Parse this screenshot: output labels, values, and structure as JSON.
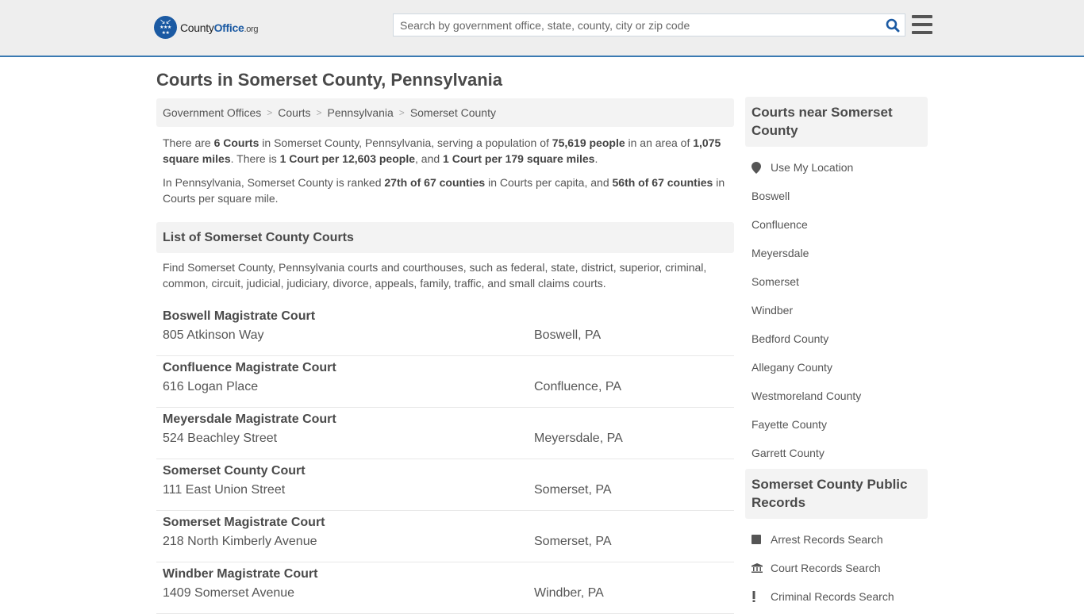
{
  "header": {
    "logo": {
      "county": "County",
      "office": "Office",
      "org": ".org"
    },
    "search_placeholder": "Search by government office, state, county, city or zip code",
    "search_value": ""
  },
  "colors": {
    "brand": "#1b5aa3",
    "header_border": "#3a7ab2",
    "header_bg": "#eeeeee",
    "panel_bg": "#f3f3f3",
    "text": "#555555"
  },
  "page": {
    "title": "Courts in Somerset County, Pennsylvania",
    "breadcrumb": [
      "Government Offices",
      "Courts",
      "Pennsylvania",
      "Somerset County"
    ],
    "intro1": {
      "t1": "There are ",
      "b1": "6 Courts",
      "t2": " in Somerset County, Pennsylvania, serving a population of ",
      "b2": "75,619 people",
      "t3": " in an area of ",
      "b3": "1,075 square miles",
      "t4": ". There is ",
      "b4": "1 Court per 12,603 people",
      "t5": ", and ",
      "b5": "1 Court per 179 square miles",
      "t6": "."
    },
    "intro2": {
      "t1": "In Pennsylvania, Somerset County is ranked ",
      "b1": "27th of 67 counties",
      "t2": " in Courts per capita, and ",
      "b2": "56th of 67 counties",
      "t3": " in Courts per square mile."
    },
    "list_heading": "List of Somerset County Courts",
    "list_desc": "Find Somerset County, Pennsylvania courts and courthouses, such as federal, state, district, superior, criminal, common, circuit, judicial, judiciary, divorce, appeals, family, traffic, and small claims courts.",
    "courts": [
      {
        "name": "Boswell Magistrate Court",
        "address": "805 Atkinson Way",
        "city": "Boswell, PA"
      },
      {
        "name": "Confluence Magistrate Court",
        "address": "616 Logan Place",
        "city": "Confluence, PA"
      },
      {
        "name": "Meyersdale Magistrate Court",
        "address": "524 Beachley Street",
        "city": "Meyersdale, PA"
      },
      {
        "name": "Somerset County Court",
        "address": "111 East Union Street",
        "city": "Somerset, PA"
      },
      {
        "name": "Somerset Magistrate Court",
        "address": "218 North Kimberly Avenue",
        "city": "Somerset, PA"
      },
      {
        "name": "Windber Magistrate Court",
        "address": "1409 Somerset Avenue",
        "city": "Windber, PA"
      }
    ]
  },
  "sidebar": {
    "near_heading": "Courts near Somerset County",
    "use_location": "Use My Location",
    "near_links": [
      "Boswell",
      "Confluence",
      "Meyersdale",
      "Somerset",
      "Windber",
      "Bedford County",
      "Allegany County",
      "Westmoreland County",
      "Fayette County",
      "Garrett County"
    ],
    "records_heading": "Somerset County Public Records",
    "records_links": [
      {
        "label": "Arrest Records Search",
        "icon": "square-icon"
      },
      {
        "label": "Court Records Search",
        "icon": "courthouse-icon"
      },
      {
        "label": "Criminal Records Search",
        "icon": "exclamation-icon"
      }
    ]
  }
}
